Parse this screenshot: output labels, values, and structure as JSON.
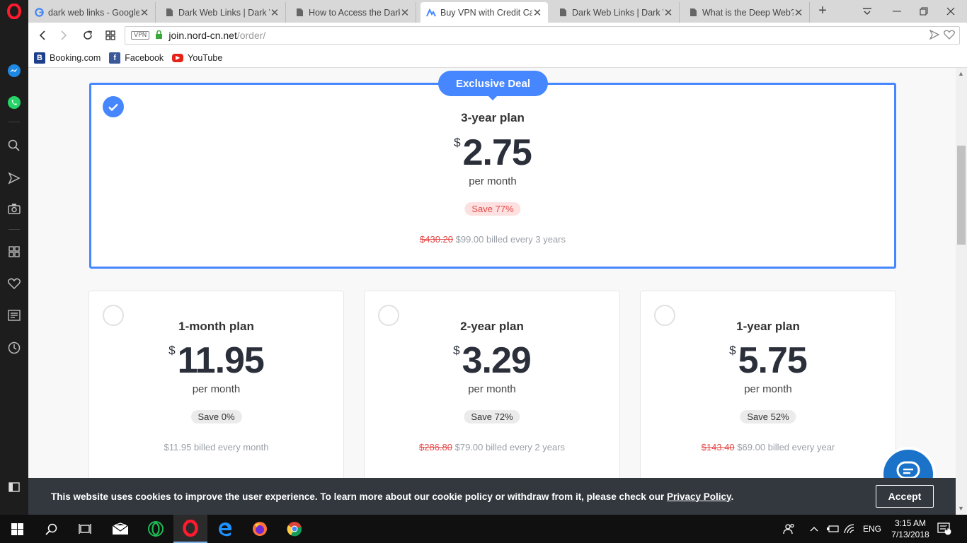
{
  "tabs": [
    {
      "title": "dark web links - Google",
      "icon": "google-icon"
    },
    {
      "title": "Dark Web Links | Dark W",
      "icon": "page-icon"
    },
    {
      "title": "How to Access the Dark",
      "icon": "page-icon"
    },
    {
      "title": "Buy VPN with Credit Car",
      "icon": "nordvpn-icon",
      "active": true
    },
    {
      "title": "Dark Web Links | Dark W",
      "icon": "page-icon"
    },
    {
      "title": "What is the Deep Web?",
      "icon": "page-icon"
    }
  ],
  "address": {
    "vpn_badge": "VPN",
    "host": "join.nord-cn.net",
    "path": "/order/"
  },
  "bookmarks": [
    {
      "label": "Booking.com",
      "badge": "B",
      "color": "#1e3f8a"
    },
    {
      "label": "Facebook",
      "badge": "f",
      "color": "#3b5998"
    },
    {
      "label": "YouTube",
      "badge": "▶",
      "color": "#e62117"
    }
  ],
  "featured": {
    "badge": "Exclusive Deal",
    "title": "3-year plan",
    "currency": "$",
    "price": "2.75",
    "per": "per month",
    "save": "Save 77%",
    "old_price": "$430.20",
    "billed": "$99.00 billed every 3 years"
  },
  "plans": [
    {
      "title": "1-month plan",
      "currency": "$",
      "price": "11.95",
      "per": "per month",
      "save": "Save 0%",
      "old_price": "",
      "billed": "$11.95 billed every month"
    },
    {
      "title": "2-year plan",
      "currency": "$",
      "price": "3.29",
      "per": "per month",
      "save": "Save 72%",
      "old_price": "$286.80",
      "billed": "$79.00 billed every 2 years"
    },
    {
      "title": "1-year plan",
      "currency": "$",
      "price": "5.75",
      "per": "per month",
      "save": "Save 52%",
      "old_price": "$143.40",
      "billed": "$69.00 billed every year"
    }
  ],
  "cookie": {
    "text": "This website uses cookies to improve the user experience. To learn more about our cookie policy or withdraw from it, please check our ",
    "link": "Privacy Policy",
    "end": ".",
    "accept": "Accept"
  },
  "taskbar": {
    "time": "3:15 AM",
    "date": "7/13/2018",
    "lang": "ENG",
    "notifications": "1"
  },
  "colors": {
    "accent": "#4687ff",
    "save_red": "#e44b4b",
    "banner": "#33383f"
  }
}
